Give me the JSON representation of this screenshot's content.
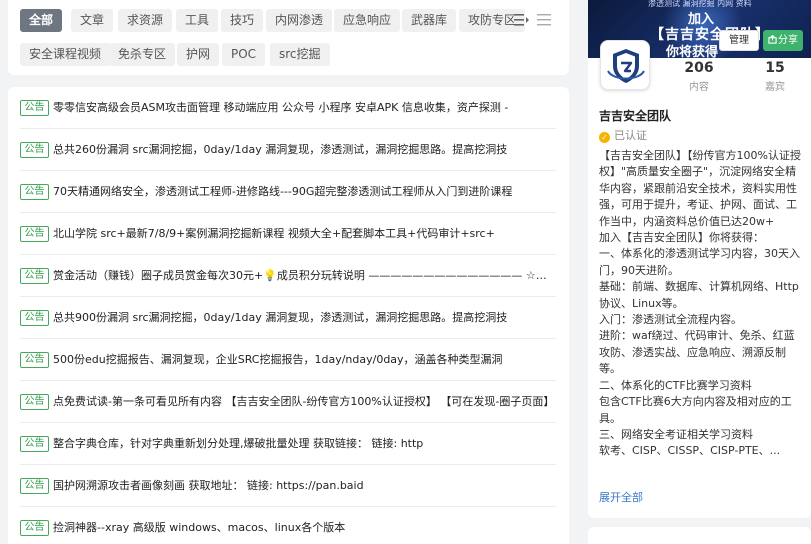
{
  "categories": {
    "items": [
      {
        "label": "全部",
        "active": true
      },
      {
        "label": "文章"
      },
      {
        "label": "求资源"
      },
      {
        "label": "工具"
      },
      {
        "label": "技巧"
      },
      {
        "label": "内网渗透"
      },
      {
        "label": "应急响应"
      },
      {
        "label": "武器库"
      },
      {
        "label": "攻防专区"
      },
      {
        "label": "安全课程视频"
      },
      {
        "label": "免杀专区"
      },
      {
        "label": "护网"
      },
      {
        "label": "POC"
      },
      {
        "label": "src挖掘"
      }
    ]
  },
  "posts": {
    "badge": "公告",
    "items": [
      "零零信安高级会员ASM攻击面管理 移动端应用 公众号 小程序 安卓APK 信息收集，资产探测 -",
      "总共260份漏洞 src漏洞挖掘，0day/1day 漏洞复现，渗透测试，漏洞挖掘思路。提高挖洞技",
      "70天精通网络安全，渗透测试工程师-进修路线---90G超完整渗透测试工程师从入门到进阶课程",
      "北山学院 src+最新7/8/9+案例漏洞挖掘新课程 视频大全+配套脚本工具+代码审计+src+",
      "赏金活动（赚钱）圈子成员赏金每次30元+💡成员积分玩转说明 ——————————————  ☆具体赏金规则",
      "总共900份漏洞 src漏洞挖掘，0day/1day 漏洞复现，渗透测试，漏洞挖掘思路。提高挖洞技",
      "500份edu挖掘报告、漏洞复现，企业SRC挖掘报告，1day/nday/0day，涵盖各种类型漏洞",
      "点免费试读-第一条可看见所有内容 【吉吉安全团队-纷传官方100%认证授权】 【可在发现-圈子页面】",
      "整合字典仓库，针对字典重新划分处理,爆破批量处理 获取链接：  链接: http",
      "国护网溯源攻击者画像刻画 获取地址：  链接: https://pan.baid",
      "捡洞神器--xray 高级版 windows、macos、linux各个版本"
    ]
  },
  "profile": {
    "banner_small": "渗透测试 漏洞挖掘 内网 资料",
    "banner_line1": "加入",
    "banner_line2": "【吉吉安全团队】",
    "banner_line3": "你将获得",
    "manage_label": "管理",
    "share_label": "分享",
    "content_count": "206",
    "content_label": "内容",
    "guest_count": "15",
    "guest_label": "嘉宾",
    "name": "吉吉安全团队",
    "verified_label": "已认证",
    "description": "【吉吉安全团队】【纷传官方100%认证授权】\"高质量安全圈子\"，沉淀网络安全精华内容，紧跟前沿安全技术，资料实用性强，可用于提升，考证、护网、面试、工作当中，内涵资料总价值已达20w+\n加入【吉吉安全团队】你将获得：\n一、体系化的渗透测试学习内容，30天入门，90天进阶。\n基础：前端、数据库、计算机网络、Http协议、Linux等。\n入门：渗透测试全流程内容。\n进阶：waf绕过、代码审计、免杀、红蓝攻防、渗透实战、应急响应、溯源反制等。\n二、体系化的CTF比赛学习资料\n包含CTF比赛6大方向内容及相对应的工具。\n三、网络安全考证相关学习资料\n软考、CISP、CISSP、CISP-PTE、...",
    "expand_label": "展开全部"
  },
  "colors": {
    "accent_green": "#3fb36d",
    "badge_green": "#2f9a4a",
    "link_blue": "#3a78c9",
    "active_tag": "#6e7681"
  }
}
